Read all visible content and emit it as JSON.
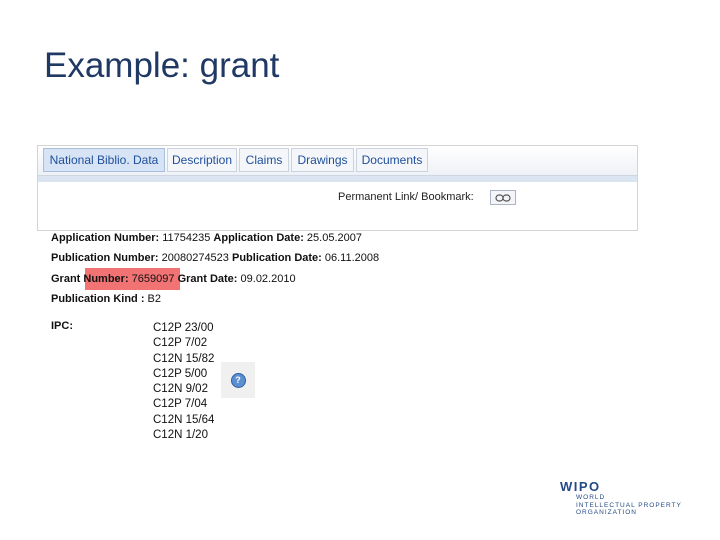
{
  "slide": {
    "title": "Example: grant"
  },
  "tabs": [
    {
      "label": "National Biblio. Data",
      "active": true
    },
    {
      "label": "Description",
      "active": false
    },
    {
      "label": "Claims",
      "active": false
    },
    {
      "label": "Drawings",
      "active": false
    },
    {
      "label": "Documents",
      "active": false
    }
  ],
  "permalink": {
    "label": "Permanent Link/ Bookmark:",
    "icon": "chain-link-icon"
  },
  "biblio": {
    "rows": [
      {
        "k1": "Application Number:",
        "v1": " 11754235 ",
        "k2": "Application Date:",
        "v2": " 25.05.2007"
      },
      {
        "k1": "Publication Number:",
        "v1": " 20080274523 ",
        "k2": "Publication Date:",
        "v2": " 06.11.2008"
      },
      {
        "k1": "Grant Number:",
        "v1": " 7659097 ",
        "k2": "Grant Date:",
        "v2": " 09.02.2010"
      }
    ],
    "kind_label": "Publication Kind :",
    "kind_value": " B2"
  },
  "ipc": {
    "label": "IPC:",
    "codes": [
      "C12P 23/00",
      "C12P 7/02",
      "C12N 15/82",
      "C12P 5/00",
      "C12N 9/02",
      "C12P 7/04",
      "C12N 15/64",
      "C12N 1/20"
    ],
    "help_icon": "question-mark-icon"
  },
  "logo": {
    "main": "WIPO",
    "line1": "WORLD",
    "line2": "INTELLECTUAL PROPERTY",
    "line3": "ORGANIZATION"
  },
  "colors": {
    "title": "#1f3864",
    "tab_text": "#1f4f9a",
    "highlight": "#f05a5a"
  }
}
